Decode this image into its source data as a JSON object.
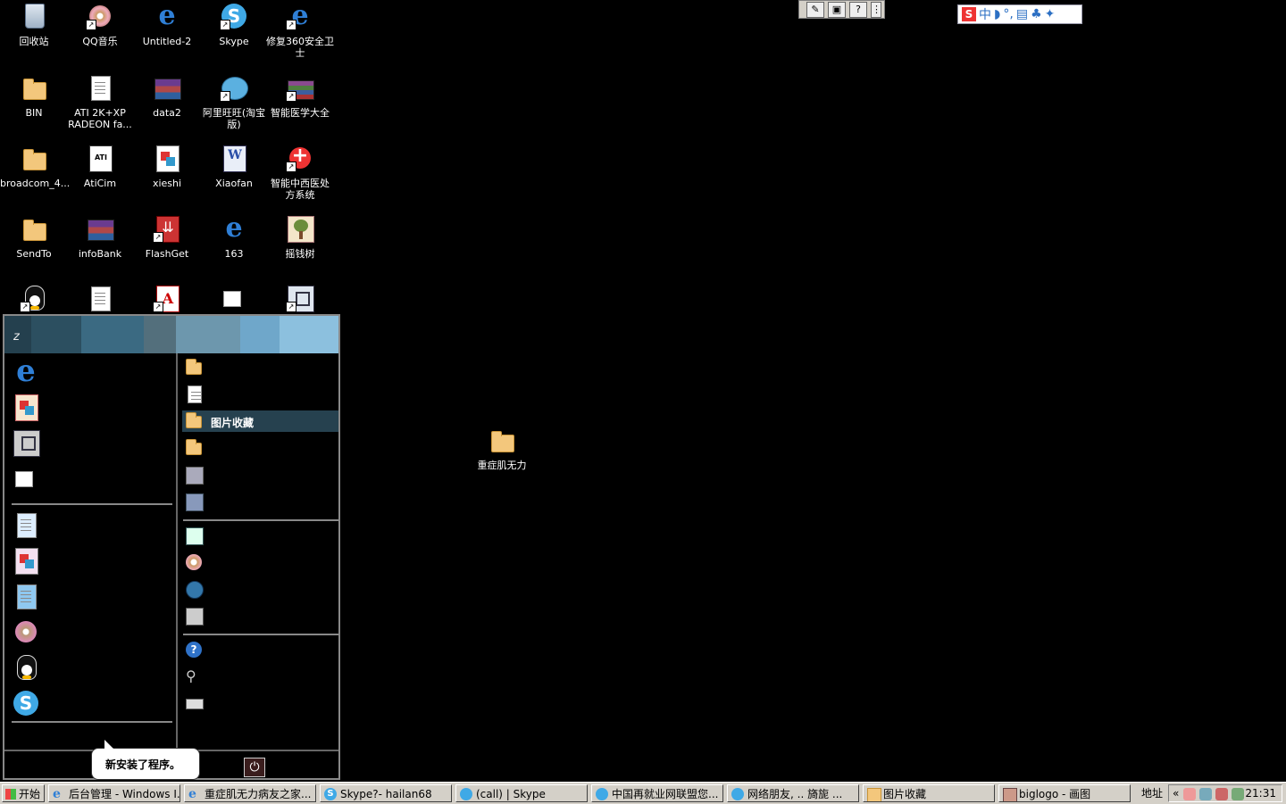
{
  "desktop": {
    "icons": [
      {
        "label": "回收站"
      },
      {
        "label": "QQ音乐"
      },
      {
        "label": "Untitled-2"
      },
      {
        "label": "Skype"
      },
      {
        "label": "修复360安全卫士"
      },
      {
        "label": "BIN"
      },
      {
        "label": "ATI 2K+XP RADEON fa..."
      },
      {
        "label": "data2"
      },
      {
        "label": "阿里旺旺(淘宝版)"
      },
      {
        "label": "智能医学大全"
      },
      {
        "label": "broadcom_4..."
      },
      {
        "label": "AtiCim"
      },
      {
        "label": "xieshi"
      },
      {
        "label": "Xiaofan"
      },
      {
        "label": "智能中西医处方系统"
      },
      {
        "label": "SendTo"
      },
      {
        "label": "infoBank"
      },
      {
        "label": "FlashGet"
      },
      {
        "label": "163"
      },
      {
        "label": "摇钱树"
      },
      {
        "label": "重症肌无力"
      }
    ]
  },
  "startmenu": {
    "user": "z",
    "right_selected": "图片收藏",
    "balloon": "新安装了程序。"
  },
  "ime": {
    "text": "中"
  },
  "taskbar": {
    "start": "开始",
    "tasks": [
      {
        "label": "后台管理 - Windows I..."
      },
      {
        "label": "重症肌无力病友之家..."
      },
      {
        "label": "Skype?- hailan68"
      },
      {
        "label": "(call) | Skype"
      },
      {
        "label": "中国再就业网联盟您..."
      },
      {
        "label": "网络朋友,  .. 旖旎  ..."
      },
      {
        "label": "图片收藏"
      },
      {
        "label": "biglogo - 画图"
      }
    ],
    "address_label": "地址",
    "chevron": "«",
    "clock": "21:31"
  }
}
